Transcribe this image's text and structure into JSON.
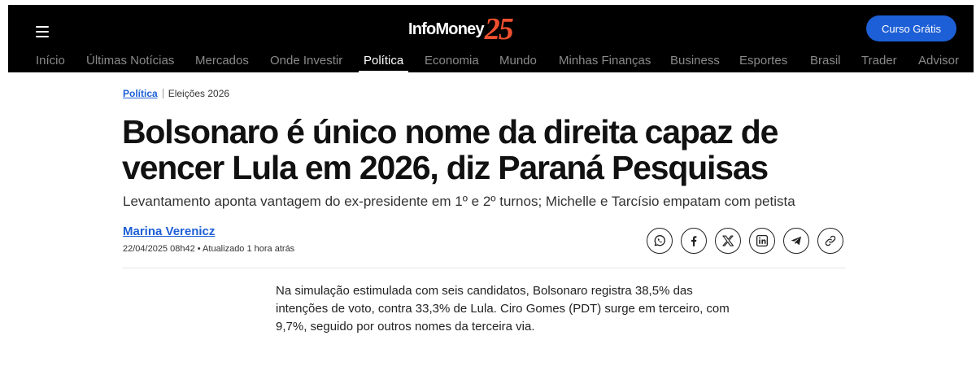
{
  "header": {
    "logo_text": "InfoMoney",
    "logo_number": "25",
    "cta_label": "Curso Grátis"
  },
  "nav": {
    "items": [
      {
        "label": "Início"
      },
      {
        "label": "Últimas Notícias"
      },
      {
        "label": "Mercados"
      },
      {
        "label": "Onde Investir"
      },
      {
        "label": "Política"
      },
      {
        "label": "Economia"
      },
      {
        "label": "Mundo"
      },
      {
        "label": "Minhas Finanças"
      },
      {
        "label": "Business"
      },
      {
        "label": "Esportes"
      },
      {
        "label": "Brasil"
      },
      {
        "label": "Trader"
      },
      {
        "label": "Advisor"
      }
    ],
    "active": "Política"
  },
  "article": {
    "breadcrumb_section": "Política",
    "breadcrumb_topic": "Eleições 2026",
    "headline": "Bolsonaro é único nome da direita capaz de vencer Lula em 2026, diz Paraná Pesquisas",
    "subheadline": "Levantamento aponta vantagem do ex-presidente em 1º e 2º turnos; Michelle e Tarcísio empatam com petista",
    "author": "Marina Verenicz",
    "meta": "22/04/2025 08h42 • Atualizado 1 hora atrás",
    "share_icons": [
      "whatsapp-icon",
      "facebook-icon",
      "x-icon",
      "linkedin-icon",
      "telegram-icon",
      "link-icon"
    ],
    "paragraph": "Na simulação estimulada com seis candidatos, Bolsonaro registra 38,5% das intenções de voto, contra 33,3% de Lula. Ciro Gomes (PDT) surge em terceiro, com 9,7%, seguido por outros nomes da terceira via."
  },
  "colors": {
    "header_bg": "#000000",
    "accent_blue": "#1d5fd6",
    "logo_number": "#f0502f"
  }
}
